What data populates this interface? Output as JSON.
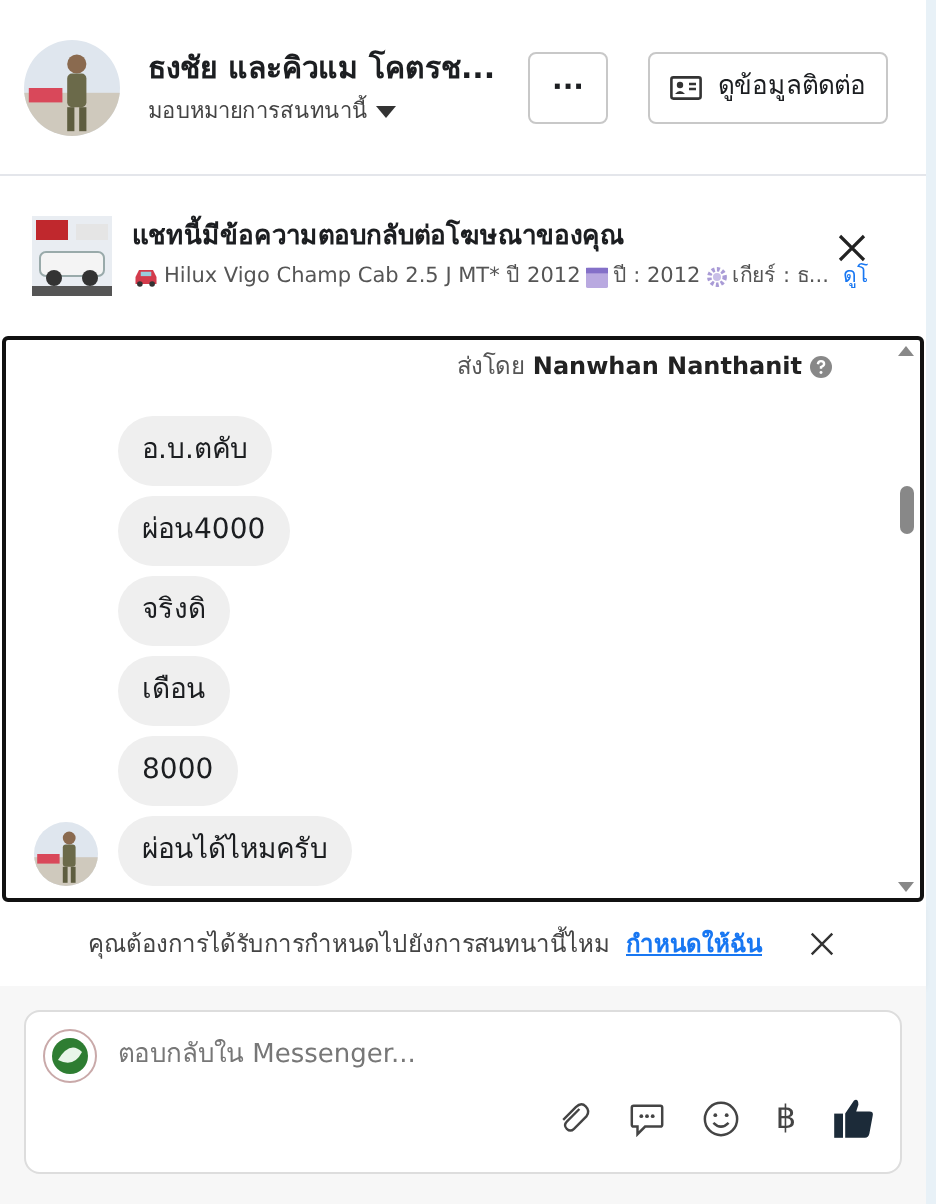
{
  "header": {
    "name": "ธงชัย และคิวแม โคตรช...",
    "assign": "มอบหมายการสนทนานี้",
    "more": "···",
    "contact_button": "ดูข้อมูลติดต่อ"
  },
  "ad_banner": {
    "title": "แชทนี้มีข้อความตอบกลับต่อโฆษณาของคุณ",
    "details": [
      "Hilux Vigo Champ Cab 2.5 J MT* ปี 2012",
      "ปี : 2012",
      "เกียร์ : ธ..."
    ],
    "link": "ดูโ"
  },
  "chat": {
    "sent_by_label": "ส่งโดย",
    "sent_by_name": "Nanwhan Nanthanit",
    "messages": [
      {
        "text": "อ.บ.ตคับ",
        "avatar": false
      },
      {
        "text": "ผ่อน4000",
        "avatar": false
      },
      {
        "text": "จริงดิ",
        "avatar": false
      },
      {
        "text": "เดือน",
        "avatar": false
      },
      {
        "text": "8000",
        "avatar": false
      },
      {
        "text": "ผ่อนได้ไหมครับ",
        "avatar": true
      }
    ]
  },
  "notice": {
    "text": "คุณต้องการได้รับการกำหนดไปยังการสนทนานี้ไหม",
    "link": "กำหนดให้ฉัน"
  },
  "composer": {
    "placeholder": "ตอบกลับใน Messenger...",
    "currency": "฿"
  }
}
